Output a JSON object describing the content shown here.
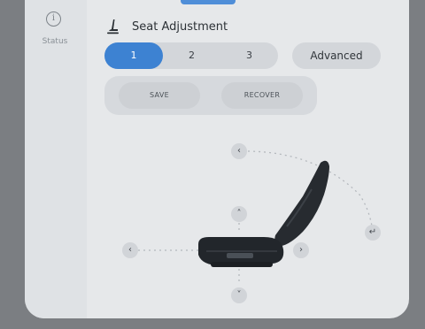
{
  "sidebar": {
    "status_label": "Status",
    "status_icon": "info-icon"
  },
  "header": {
    "title": "Seat Adjustment",
    "seat_icon": "seat-icon"
  },
  "presets": {
    "items": [
      {
        "label": "1",
        "active": true
      },
      {
        "label": "2",
        "active": false
      },
      {
        "label": "3",
        "active": false
      }
    ],
    "advanced_label": "Advanced"
  },
  "memory": {
    "save_label": "SAVE",
    "recover_label": "RECOVER"
  },
  "controls": {
    "backrest_forward_icon": "chevron-left-icon",
    "seat_up_icon": "chevron-up-icon",
    "seat_down_icon": "chevron-down-icon",
    "seat_forward_icon": "chevron-left-icon",
    "seat_backward_icon": "chevron-right-icon",
    "backrest_backward_icon": "recline-icon"
  },
  "colors": {
    "accent": "#3d82d2",
    "panel": "#e6e8ea",
    "background": "#7b7e82"
  }
}
